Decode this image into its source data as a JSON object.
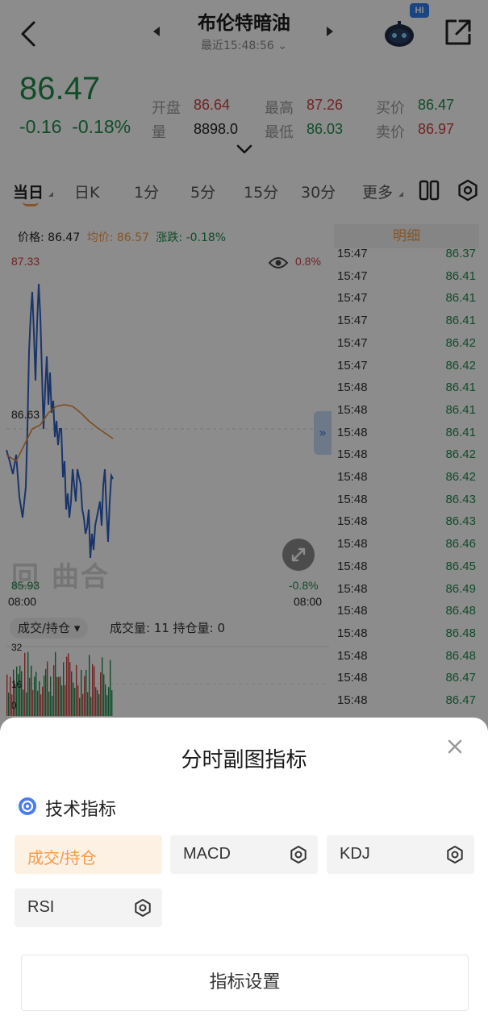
{
  "header": {
    "title": "布伦特暗油",
    "subtitle": "最近15:48:56",
    "badge": "HI"
  },
  "quote": {
    "price": "86.47",
    "change": "-0.16",
    "change_pct": "-0.18%",
    "items": [
      {
        "label": "开盘",
        "value": "86.64",
        "color": "red"
      },
      {
        "label": "最高",
        "value": "87.26",
        "color": "red"
      },
      {
        "label": "买价",
        "value": "86.47",
        "color": "green"
      },
      {
        "label": "量",
        "value": "8898.0",
        "color": "dark"
      },
      {
        "label": "最低",
        "value": "86.03",
        "color": "green"
      },
      {
        "label": "卖价",
        "value": "86.97",
        "color": "red"
      }
    ]
  },
  "tabs": [
    "当日",
    "日K",
    "1分",
    "5分",
    "15分",
    "30分",
    "更多"
  ],
  "chart": {
    "legend_price": "价格: 86.47",
    "legend_avg": "均价: 86.57",
    "legend_chg": "涨跌: -0.18%",
    "top_price": "87.33",
    "top_pct": "0.8%",
    "mid_price": "86.63",
    "low_price": "85.93",
    "low_pct": "-0.8%",
    "time_start": "08:00",
    "time_end": "08:00",
    "watermark": "曲合",
    "collapse": "»",
    "sub_select": "成交/持仓 ▾",
    "sub_info": "成交量: 11 持仓量: 0",
    "sub_top": "32",
    "sub_mid": "16",
    "sub_bot": "0"
  },
  "detail": {
    "header": "明细",
    "rows": [
      {
        "time": "15:47",
        "price": "86.37"
      },
      {
        "time": "15:47",
        "price": "86.41"
      },
      {
        "time": "15:47",
        "price": "86.41"
      },
      {
        "time": "15:47",
        "price": "86.41"
      },
      {
        "time": "15:47",
        "price": "86.42"
      },
      {
        "time": "15:47",
        "price": "86.42"
      },
      {
        "time": "15:48",
        "price": "86.41"
      },
      {
        "time": "15:48",
        "price": "86.41"
      },
      {
        "time": "15:48",
        "price": "86.41"
      },
      {
        "time": "15:48",
        "price": "86.42"
      },
      {
        "time": "15:48",
        "price": "86.42"
      },
      {
        "time": "15:48",
        "price": "86.43"
      },
      {
        "time": "15:48",
        "price": "86.43"
      },
      {
        "time": "15:48",
        "price": "86.46"
      },
      {
        "time": "15:48",
        "price": "86.45"
      },
      {
        "time": "15:48",
        "price": "86.49"
      },
      {
        "time": "15:48",
        "price": "86.48"
      },
      {
        "time": "15:48",
        "price": "86.48"
      },
      {
        "time": "15:48",
        "price": "86.48"
      },
      {
        "time": "15:48",
        "price": "86.47"
      },
      {
        "time": "15:48",
        "price": "86.47"
      }
    ]
  },
  "sheet": {
    "title": "分时副图指标",
    "section": "技术指标",
    "indicators": [
      {
        "label": "成交/持仓",
        "active": true,
        "gear": false
      },
      {
        "label": "MACD",
        "active": false,
        "gear": true
      },
      {
        "label": "KDJ",
        "active": false,
        "gear": true
      },
      {
        "label": "RSI",
        "active": false,
        "gear": true
      }
    ],
    "settings_button": "指标设置"
  },
  "colors": {
    "up": "#d04040",
    "down": "#1f8a4c",
    "accent": "#f39c48",
    "line": "#2f5fc4"
  }
}
